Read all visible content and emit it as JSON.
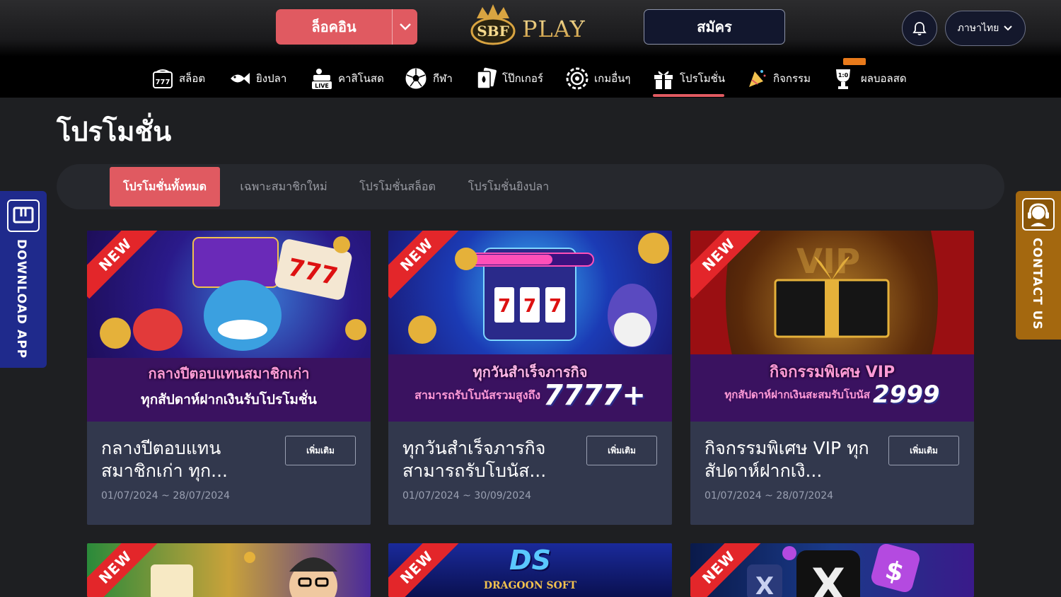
{
  "header": {
    "login_label": "ล็อคอิน",
    "register_label": "สมัคร",
    "logo_text": "PLAY",
    "logo_badge_text": "SBF",
    "language_label": "ภาษาไทย"
  },
  "nav": {
    "items": [
      {
        "label": "สล็อต",
        "icon": "slot-machine-icon"
      },
      {
        "label": "ยิงปลา",
        "icon": "fish-icon"
      },
      {
        "label": "คาสิโนสด",
        "icon": "live-casino-icon"
      },
      {
        "label": "กีฬา",
        "icon": "soccer-ball-icon"
      },
      {
        "label": "โป๊กเกอร์",
        "icon": "cards-icon"
      },
      {
        "label": "เกมอื่นๆ",
        "icon": "chip-icon"
      },
      {
        "label": "โปรโมชั่น",
        "icon": "gift-icon"
      },
      {
        "label": "กิจกรรม",
        "icon": "party-icon"
      },
      {
        "label": "ผลบอลสด",
        "icon": "trophy-icon"
      }
    ],
    "active": "โปรโมชั่น"
  },
  "page": {
    "title": "โปรโมชั่น"
  },
  "tabs": [
    {
      "label": "โปรโมชั่นทั้งหมด",
      "active": true
    },
    {
      "label": "เฉพาะสมาชิกใหม่",
      "active": false
    },
    {
      "label": "โปรโมชั่นสล็อต",
      "active": false
    },
    {
      "label": "โปรโมชั่นยิงปลา",
      "active": false
    }
  ],
  "side": {
    "download_label": "DOWNLOAD APP",
    "contact_label": "CONTACT US"
  },
  "cards": [
    {
      "title": "กลางปีตอบแทน สมาชิกเก่า ทุก...",
      "date": "01/07/2024 ~ 28/07/2024",
      "more": "เพิ่มเติม",
      "ribbon": "NEW",
      "banner_line1": "กลางปีตอบแทนสมาชิกเก่า",
      "banner_line2": "ทุกสัปดาห์ฝากเงินรับโปรโมชั่น"
    },
    {
      "title": "ทุกวันสำเร็จภารกิจ สามารถรับโบนัส...",
      "date": "01/07/2024 ~ 30/09/2024",
      "more": "เพิ่มเติม",
      "ribbon": "NEW",
      "banner_line1": "ทุกวันสำเร็จภารกิจ",
      "banner_line2": "สามารถรับโบนัสรวมสูงถึง",
      "banner_number": "7777+"
    },
    {
      "title": "กิจกรรมพิเศษ VIP ทุกสัปดาห์ฝากเงิ...",
      "date": "01/07/2024 ~ 28/07/2024",
      "more": "เพิ่มเติม",
      "ribbon": "NEW",
      "banner_line1": "กิจกรรมพิเศษ VIP",
      "banner_line2": "ทุกสัปดาห์ฝากเงินสะสมรับโบนัส",
      "banner_number": "2999"
    }
  ],
  "cards_row2": [
    {
      "ribbon": "NEW"
    },
    {
      "ribbon": "NEW",
      "banner_logo": "DS",
      "banner_sub": "DRAGOON SOFT"
    },
    {
      "ribbon": "NEW"
    }
  ],
  "colors": {
    "accent": "#e05a61",
    "card_bg": "#32384d",
    "page_bg": "#1e1f22",
    "download_bg": "#1f2a8c",
    "contact_bg": "#a4680f"
  }
}
